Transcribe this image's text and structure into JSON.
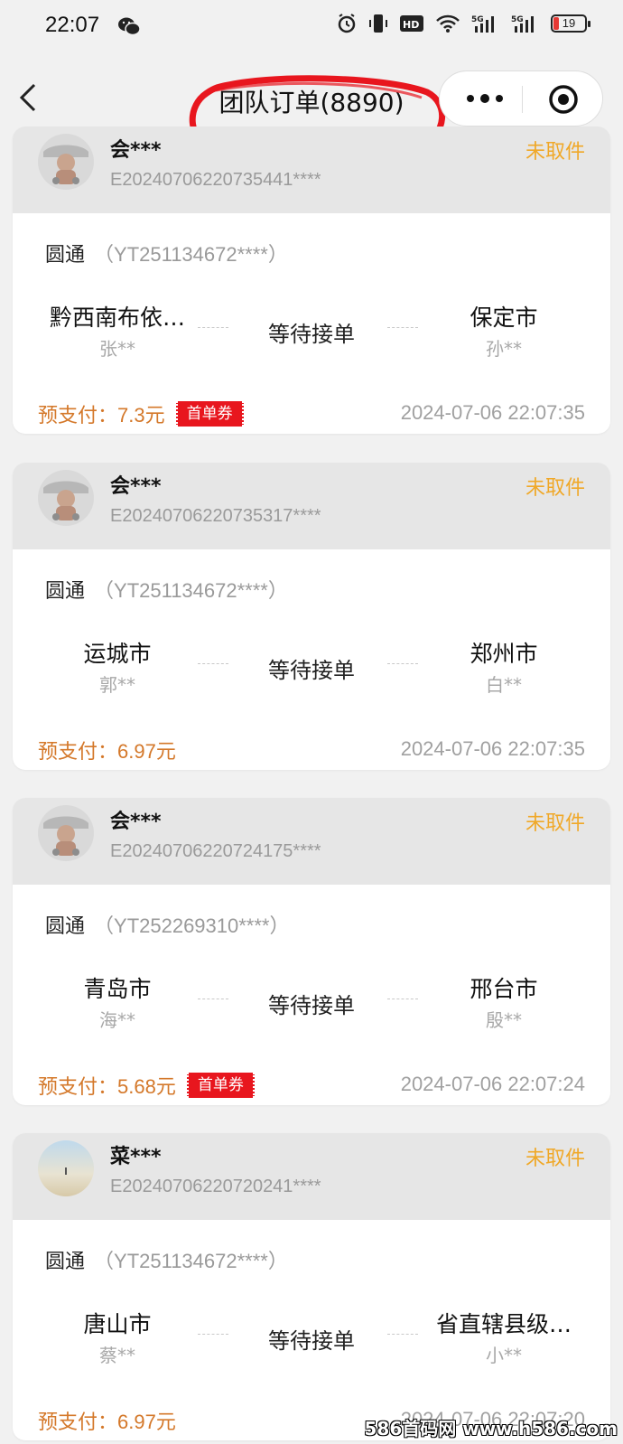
{
  "status_bar": {
    "time": "22:07",
    "battery": "19"
  },
  "nav": {
    "title": "团队订单(8890)"
  },
  "orders": [
    {
      "user": "会***",
      "order_no": "E20240706220735441****",
      "status": "未取件",
      "courier": "圆通",
      "waybill": "（YT251134672****）",
      "from_city": "黔西南布依…",
      "from_person": "张**",
      "mid_status": "等待接单",
      "to_city": "保定市",
      "to_person": "孙**",
      "pay_label": "预支付：",
      "pay_amount": "7.3元",
      "coupon": "首单券",
      "time": "2024-07-06 22:07:35"
    },
    {
      "user": "会***",
      "order_no": "E20240706220735317****",
      "status": "未取件",
      "courier": "圆通",
      "waybill": "（YT251134672****）",
      "from_city": "运城市",
      "from_person": "郭**",
      "mid_status": "等待接单",
      "to_city": "郑州市",
      "to_person": "白**",
      "pay_label": "预支付：",
      "pay_amount": "6.97元",
      "time": "2024-07-06 22:07:35"
    },
    {
      "user": "会***",
      "order_no": "E20240706220724175****",
      "status": "未取件",
      "courier": "圆通",
      "waybill": "（YT252269310****）",
      "from_city": "青岛市",
      "from_person": "海**",
      "mid_status": "等待接单",
      "to_city": "邢台市",
      "to_person": "殷**",
      "pay_label": "预支付：",
      "pay_amount": "5.68元",
      "coupon": "首单券",
      "time": "2024-07-06 22:07:24"
    },
    {
      "user": "菜***",
      "order_no": "E20240706220720241****",
      "status": "未取件",
      "courier": "圆通",
      "waybill": "（YT251134672****）",
      "from_city": "唐山市",
      "from_person": "蔡**",
      "mid_status": "等待接单",
      "to_city": "省直辖县级…",
      "to_person": "小**",
      "pay_label": "预支付：",
      "pay_amount": "6.97元",
      "time": "2024-07-06 22:07:20"
    }
  ],
  "watermark": "586首码网 www.h586.com",
  "colors": {
    "status": "#f0a828",
    "pay": "#d4782a",
    "coupon_bg": "#e8161e",
    "annotation": "#e8161e"
  }
}
